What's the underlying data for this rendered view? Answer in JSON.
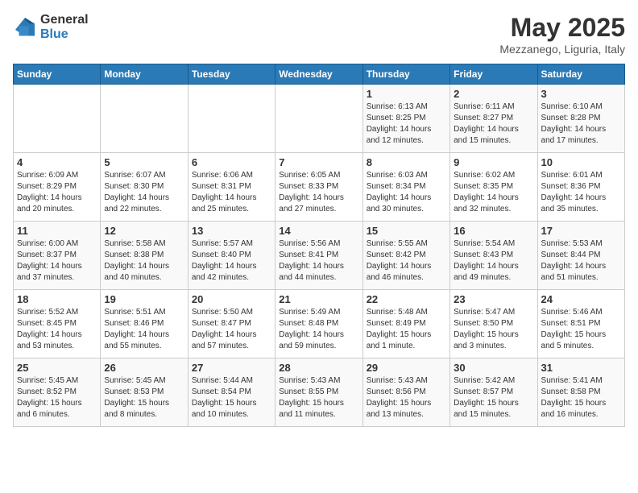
{
  "logo": {
    "general": "General",
    "blue": "Blue"
  },
  "title": "May 2025",
  "subtitle": "Mezzanego, Liguria, Italy",
  "days_of_week": [
    "Sunday",
    "Monday",
    "Tuesday",
    "Wednesday",
    "Thursday",
    "Friday",
    "Saturday"
  ],
  "weeks": [
    [
      {
        "day": "",
        "content": ""
      },
      {
        "day": "",
        "content": ""
      },
      {
        "day": "",
        "content": ""
      },
      {
        "day": "",
        "content": ""
      },
      {
        "day": "1",
        "content": "Sunrise: 6:13 AM\nSunset: 8:25 PM\nDaylight: 14 hours\nand 12 minutes."
      },
      {
        "day": "2",
        "content": "Sunrise: 6:11 AM\nSunset: 8:27 PM\nDaylight: 14 hours\nand 15 minutes."
      },
      {
        "day": "3",
        "content": "Sunrise: 6:10 AM\nSunset: 8:28 PM\nDaylight: 14 hours\nand 17 minutes."
      }
    ],
    [
      {
        "day": "4",
        "content": "Sunrise: 6:09 AM\nSunset: 8:29 PM\nDaylight: 14 hours\nand 20 minutes."
      },
      {
        "day": "5",
        "content": "Sunrise: 6:07 AM\nSunset: 8:30 PM\nDaylight: 14 hours\nand 22 minutes."
      },
      {
        "day": "6",
        "content": "Sunrise: 6:06 AM\nSunset: 8:31 PM\nDaylight: 14 hours\nand 25 minutes."
      },
      {
        "day": "7",
        "content": "Sunrise: 6:05 AM\nSunset: 8:33 PM\nDaylight: 14 hours\nand 27 minutes."
      },
      {
        "day": "8",
        "content": "Sunrise: 6:03 AM\nSunset: 8:34 PM\nDaylight: 14 hours\nand 30 minutes."
      },
      {
        "day": "9",
        "content": "Sunrise: 6:02 AM\nSunset: 8:35 PM\nDaylight: 14 hours\nand 32 minutes."
      },
      {
        "day": "10",
        "content": "Sunrise: 6:01 AM\nSunset: 8:36 PM\nDaylight: 14 hours\nand 35 minutes."
      }
    ],
    [
      {
        "day": "11",
        "content": "Sunrise: 6:00 AM\nSunset: 8:37 PM\nDaylight: 14 hours\nand 37 minutes."
      },
      {
        "day": "12",
        "content": "Sunrise: 5:58 AM\nSunset: 8:38 PM\nDaylight: 14 hours\nand 40 minutes."
      },
      {
        "day": "13",
        "content": "Sunrise: 5:57 AM\nSunset: 8:40 PM\nDaylight: 14 hours\nand 42 minutes."
      },
      {
        "day": "14",
        "content": "Sunrise: 5:56 AM\nSunset: 8:41 PM\nDaylight: 14 hours\nand 44 minutes."
      },
      {
        "day": "15",
        "content": "Sunrise: 5:55 AM\nSunset: 8:42 PM\nDaylight: 14 hours\nand 46 minutes."
      },
      {
        "day": "16",
        "content": "Sunrise: 5:54 AM\nSunset: 8:43 PM\nDaylight: 14 hours\nand 49 minutes."
      },
      {
        "day": "17",
        "content": "Sunrise: 5:53 AM\nSunset: 8:44 PM\nDaylight: 14 hours\nand 51 minutes."
      }
    ],
    [
      {
        "day": "18",
        "content": "Sunrise: 5:52 AM\nSunset: 8:45 PM\nDaylight: 14 hours\nand 53 minutes."
      },
      {
        "day": "19",
        "content": "Sunrise: 5:51 AM\nSunset: 8:46 PM\nDaylight: 14 hours\nand 55 minutes."
      },
      {
        "day": "20",
        "content": "Sunrise: 5:50 AM\nSunset: 8:47 PM\nDaylight: 14 hours\nand 57 minutes."
      },
      {
        "day": "21",
        "content": "Sunrise: 5:49 AM\nSunset: 8:48 PM\nDaylight: 14 hours\nand 59 minutes."
      },
      {
        "day": "22",
        "content": "Sunrise: 5:48 AM\nSunset: 8:49 PM\nDaylight: 15 hours\nand 1 minute."
      },
      {
        "day": "23",
        "content": "Sunrise: 5:47 AM\nSunset: 8:50 PM\nDaylight: 15 hours\nand 3 minutes."
      },
      {
        "day": "24",
        "content": "Sunrise: 5:46 AM\nSunset: 8:51 PM\nDaylight: 15 hours\nand 5 minutes."
      }
    ],
    [
      {
        "day": "25",
        "content": "Sunrise: 5:45 AM\nSunset: 8:52 PM\nDaylight: 15 hours\nand 6 minutes."
      },
      {
        "day": "26",
        "content": "Sunrise: 5:45 AM\nSunset: 8:53 PM\nDaylight: 15 hours\nand 8 minutes."
      },
      {
        "day": "27",
        "content": "Sunrise: 5:44 AM\nSunset: 8:54 PM\nDaylight: 15 hours\nand 10 minutes."
      },
      {
        "day": "28",
        "content": "Sunrise: 5:43 AM\nSunset: 8:55 PM\nDaylight: 15 hours\nand 11 minutes."
      },
      {
        "day": "29",
        "content": "Sunrise: 5:43 AM\nSunset: 8:56 PM\nDaylight: 15 hours\nand 13 minutes."
      },
      {
        "day": "30",
        "content": "Sunrise: 5:42 AM\nSunset: 8:57 PM\nDaylight: 15 hours\nand 15 minutes."
      },
      {
        "day": "31",
        "content": "Sunrise: 5:41 AM\nSunset: 8:58 PM\nDaylight: 15 hours\nand 16 minutes."
      }
    ]
  ]
}
